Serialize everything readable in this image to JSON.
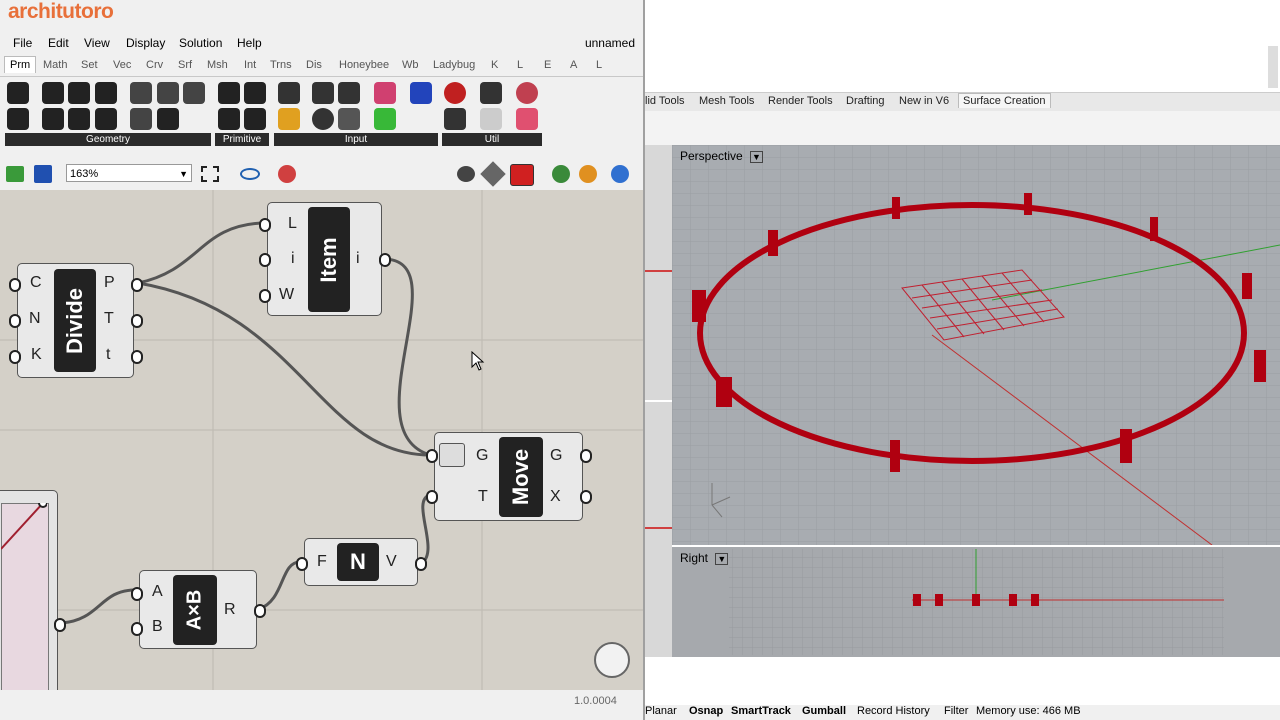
{
  "logo": {
    "text": "architutoro"
  },
  "gh": {
    "menu": [
      "File",
      "Edit",
      "View",
      "Display",
      "Solution",
      "Help"
    ],
    "document_title": "unnamed",
    "tabs": [
      "Prm",
      "Math",
      "Set",
      "Vec",
      "Crv",
      "Srf",
      "Msh",
      "Int",
      "Trns",
      "Dis",
      "Honeybee",
      "Wb",
      "Ladybug",
      "K",
      "L",
      "E",
      "A",
      "L"
    ],
    "active_tab": "Prm",
    "ribbon_groups": [
      "Geometry",
      "Primitive",
      "Input",
      "Util"
    ],
    "zoom": "163%",
    "components": {
      "divide": {
        "title": "Divide",
        "inputs": [
          "C",
          "N",
          "K"
        ],
        "outputs": [
          "P",
          "T",
          "t"
        ]
      },
      "item": {
        "title": "Item",
        "inputs": [
          "L",
          "i",
          "W"
        ],
        "outputs": [
          "i"
        ]
      },
      "move": {
        "title": "Move",
        "inputs": [
          "G",
          "T"
        ],
        "outputs": [
          "G",
          "X"
        ]
      },
      "unit": {
        "title": "N",
        "inputs": [
          "F"
        ],
        "outputs": [
          "V"
        ]
      },
      "multiply": {
        "title": "A×B",
        "inputs": [
          "A",
          "B"
        ],
        "outputs": [
          "R"
        ]
      }
    },
    "version": "1.0.0004"
  },
  "rhino": {
    "tabs": [
      "lid Tools",
      "Mesh Tools",
      "Render Tools",
      "Drafting",
      "New in V6",
      "Surface Creation"
    ],
    "active_tab": "Surface Creation",
    "viewport_perspective": "Perspective",
    "viewport_right": "Right",
    "status": {
      "planar": "Planar",
      "osnap": "Osnap",
      "smarttrack": "SmartTrack",
      "gumball": "Gumball",
      "record_history": "Record History",
      "filter": "Filter",
      "memory": "Memory use: 466 MB"
    }
  },
  "colors": {
    "accent": "#e8703a",
    "curve": "#b00010",
    "component_dark": "#222222"
  }
}
